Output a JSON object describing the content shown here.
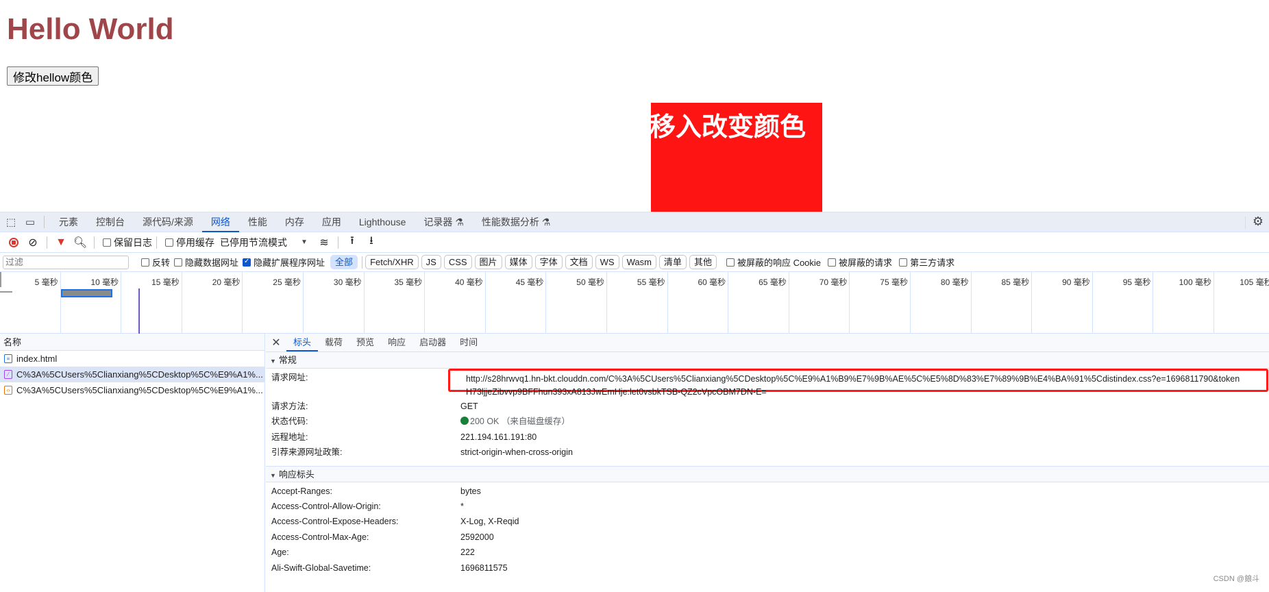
{
  "page": {
    "heading": "Hello World",
    "button_label": "修改hellow颜色",
    "hover_box_text": "移入改变颜色",
    "heading_color": "#a0464a",
    "hover_box_color": "#ff1414"
  },
  "devtools": {
    "tabs": [
      "元素",
      "控制台",
      "源代码/来源",
      "网络",
      "性能",
      "内存",
      "应用",
      "Lighthouse",
      "记录器 ⚗",
      "性能数据分析 ⚗"
    ],
    "active_tab": "网络",
    "toolbar": {
      "preserve_log": "保留日志",
      "disable_cache": "停用缓存",
      "throttling": "已停用节流模式"
    },
    "filter": {
      "placeholder": "过滤",
      "invert": "反转",
      "hide_data_urls": "隐藏数据网址",
      "hide_extension_urls": "隐藏扩展程序网址",
      "chips": [
        "全部",
        "Fetch/XHR",
        "JS",
        "CSS",
        "图片",
        "媒体",
        "字体",
        "文档",
        "WS",
        "Wasm",
        "清单",
        "其他"
      ],
      "active_chip": "全部",
      "blocked_cookies": "被屏蔽的响应 Cookie",
      "blocked_requests": "被屏蔽的请求",
      "third_party": "第三方请求"
    },
    "overview_ticks": [
      "5 毫秒",
      "10 毫秒",
      "15 毫秒",
      "20 毫秒",
      "25 毫秒",
      "30 毫秒",
      "35 毫秒",
      "40 毫秒",
      "45 毫秒",
      "50 毫秒",
      "55 毫秒",
      "60 毫秒",
      "65 毫秒",
      "70 毫秒",
      "75 毫秒",
      "80 毫秒",
      "85 毫秒",
      "90 毫秒",
      "95 毫秒",
      "100 毫秒",
      "105 毫秒"
    ],
    "request_list": {
      "header": "名称",
      "items": [
        {
          "name": "index.html",
          "type": "doc"
        },
        {
          "name": "C%3A%5CUsers%5Clianxiang%5CDesktop%5C%E9%A1%...",
          "type": "css"
        },
        {
          "name": "C%3A%5CUsers%5Clianxiang%5CDesktop%5C%E9%A1%...",
          "type": "js"
        }
      ]
    },
    "detail": {
      "tabs": [
        "标头",
        "载荷",
        "预览",
        "响应",
        "启动器",
        "时间"
      ],
      "active_tab": "标头",
      "general_section": "常规",
      "request_url_label": "请求网址:",
      "request_url": "http://s28hrwvq1.hn-bkt.clouddn.com/C%3A%5CUsers%5Clianxiang%5CDesktop%5C%E9%A1%B9%E7%9B%AE%5C%E5%8D%83%E7%89%9B%E4%BA%91%5Cdistindex.css?e=1696811790&token",
      "request_url_cont": "H73ljjeZibvvp9BFFhun393xA813JwEmHje:let0vsbkTSB-QZ2cVpcOBM7DN-E=",
      "general": [
        {
          "k": "请求方法:",
          "v": "GET"
        },
        {
          "k": "状态代码:",
          "v": "200 OK",
          "note": "（来自磁盘缓存）"
        },
        {
          "k": "远程地址:",
          "v": "221.194.161.191:80"
        },
        {
          "k": "引荐来源网址政策:",
          "v": "strict-origin-when-cross-origin"
        }
      ],
      "response_section": "响应标头",
      "response_headers": [
        {
          "k": "Accept-Ranges:",
          "v": "bytes"
        },
        {
          "k": "Access-Control-Allow-Origin:",
          "v": "*"
        },
        {
          "k": "Access-Control-Expose-Headers:",
          "v": "X-Log, X-Reqid"
        },
        {
          "k": "Access-Control-Max-Age:",
          "v": "2592000"
        },
        {
          "k": "Age:",
          "v": "222"
        },
        {
          "k": "Ali-Swift-Global-Savetime:",
          "v": "1696811575"
        }
      ]
    }
  },
  "watermark": "CSDN @鋃斗"
}
